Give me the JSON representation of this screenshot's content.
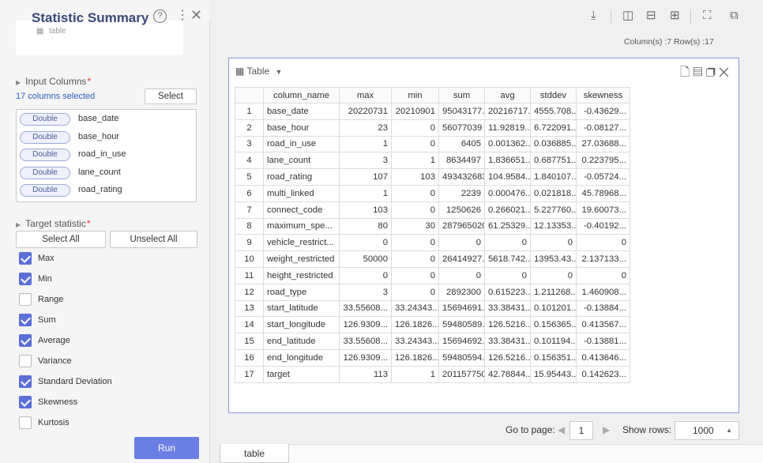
{
  "panel": {
    "title": "Statistic Summary",
    "table_label": "table",
    "input_columns_title": "Input Columns",
    "columns_selected": "17 columns selected",
    "select_label": "Select",
    "columns": [
      {
        "type": "Double",
        "name": "base_date"
      },
      {
        "type": "Double",
        "name": "base_hour"
      },
      {
        "type": "Double",
        "name": "road_in_use"
      },
      {
        "type": "Double",
        "name": "lane_count"
      },
      {
        "type": "Double",
        "name": "road_rating"
      }
    ],
    "target_title": "Target statistic",
    "select_all": "Select All",
    "unselect_all": "Unselect All",
    "stats": [
      {
        "label": "Max",
        "checked": true
      },
      {
        "label": "Min",
        "checked": true
      },
      {
        "label": "Range",
        "checked": false
      },
      {
        "label": "Sum",
        "checked": true
      },
      {
        "label": "Average",
        "checked": true
      },
      {
        "label": "Variance",
        "checked": false
      },
      {
        "label": "Standard Deviation",
        "checked": true
      },
      {
        "label": "Skewness",
        "checked": true
      },
      {
        "label": "Kurtosis",
        "checked": false
      }
    ],
    "run_label": "Run"
  },
  "toolbar": {
    "counts": "Column(s) :7   Row(s) :17"
  },
  "card": {
    "title": "Table"
  },
  "table": {
    "headers": [
      "",
      "column_name",
      "max",
      "min",
      "sum",
      "avg",
      "stddev",
      "skewness"
    ],
    "rows": [
      [
        "1",
        "base_date",
        "20220731",
        "20210901",
        "95043177...",
        "20216717...",
        "4555.708...",
        "-0.43629..."
      ],
      [
        "2",
        "base_hour",
        "23",
        "0",
        "56077039",
        "11.92819...",
        "6.722091...",
        "-0.08127..."
      ],
      [
        "3",
        "road_in_use",
        "1",
        "0",
        "6405",
        "0.001362...",
        "0.036885...",
        "27.03688..."
      ],
      [
        "4",
        "lane_count",
        "3",
        "1",
        "8634497",
        "1.836651...",
        "0.687751...",
        "0.223795..."
      ],
      [
        "5",
        "road_rating",
        "107",
        "103",
        "493432683",
        "104.9584...",
        "1.840107...",
        "-0.05724..."
      ],
      [
        "6",
        "multi_linked",
        "1",
        "0",
        "2239",
        "0.000476...",
        "0.021818...",
        "45.78968..."
      ],
      [
        "7",
        "connect_code",
        "103",
        "0",
        "1250626",
        "0.266021...",
        "5.227760...",
        "19.60073..."
      ],
      [
        "8",
        "maximum_spe...",
        "80",
        "30",
        "287965020",
        "61.25329...",
        "12.13353...",
        "-0.40192..."
      ],
      [
        "9",
        "vehicle_restrict...",
        "0",
        "0",
        "0",
        "0",
        "0",
        "0"
      ],
      [
        "10",
        "weight_restricted",
        "50000",
        "0",
        "26414927...",
        "5618.742...",
        "13953.43...",
        "2.137133..."
      ],
      [
        "11",
        "height_restricted",
        "0",
        "0",
        "0",
        "0",
        "0",
        "0"
      ],
      [
        "12",
        "road_type",
        "3",
        "0",
        "2892300",
        "0.615223...",
        "1.211268...",
        "1.460908..."
      ],
      [
        "13",
        "start_latitude",
        "33.55608...",
        "33.24343...",
        "15694691...",
        "33.38431...",
        "0.101201...",
        "-0.13884..."
      ],
      [
        "14",
        "start_longitude",
        "126.9309...",
        "126.1826...",
        "59480589...",
        "126.5216...",
        "0.156365...",
        "0.413567..."
      ],
      [
        "15",
        "end_latitude",
        "33.55608...",
        "33.24343...",
        "15694692...",
        "33.38431...",
        "0.101194...",
        "-0.13881..."
      ],
      [
        "16",
        "end_longitude",
        "126.9309...",
        "126.1826...",
        "59480594...",
        "126.5216...",
        "0.156351...",
        "0.413646..."
      ],
      [
        "17",
        "target",
        "113",
        "1",
        "201157750",
        "42.78844...",
        "15.95443...",
        "0.142623..."
      ]
    ]
  },
  "pager": {
    "goto_label": "Go to page:",
    "page": "1",
    "show_rows_label": "Show rows:",
    "rows_value": "1000"
  },
  "tabs": {
    "active": "table"
  }
}
